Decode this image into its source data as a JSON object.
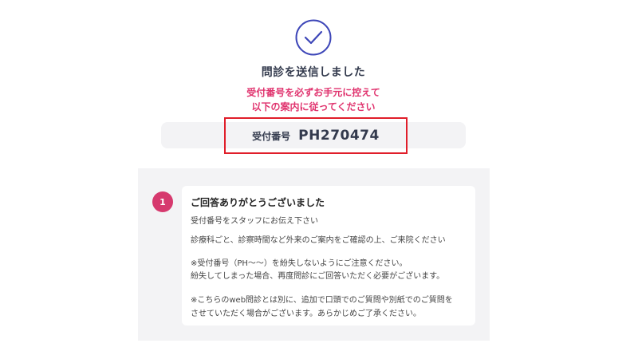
{
  "header": {
    "icon": "check-circle-icon",
    "title": "問診を送信しました",
    "notice_line1": "受付番号を必ずお手元に控えて",
    "notice_line2": "以下の案内に従ってください"
  },
  "receipt": {
    "label": "受付番号",
    "number": "PH270474"
  },
  "info": {
    "step_number": "1",
    "heading": "ご回答ありがとうございました",
    "lines": [
      "受付番号をスタッフにお伝え下さい",
      "診療科ごと、診察時間など外来のご案内をご確認の上、ご来院ください",
      "※受付番号（PH〜〜）を紛失しないようにご注意ください。",
      "紛失してしまった場合、再度問診にご回答いただく必要がございます。",
      "※こちらのweb問診とは別に、追加で口頭でのご質問や別紙でのご質問を",
      "させていただく場合がございます。あらかじめご了承ください。"
    ]
  },
  "colors": {
    "accent_pink": "#e0336e",
    "highlight_red": "#e01e2a",
    "check_blue": "#3d46b8"
  }
}
